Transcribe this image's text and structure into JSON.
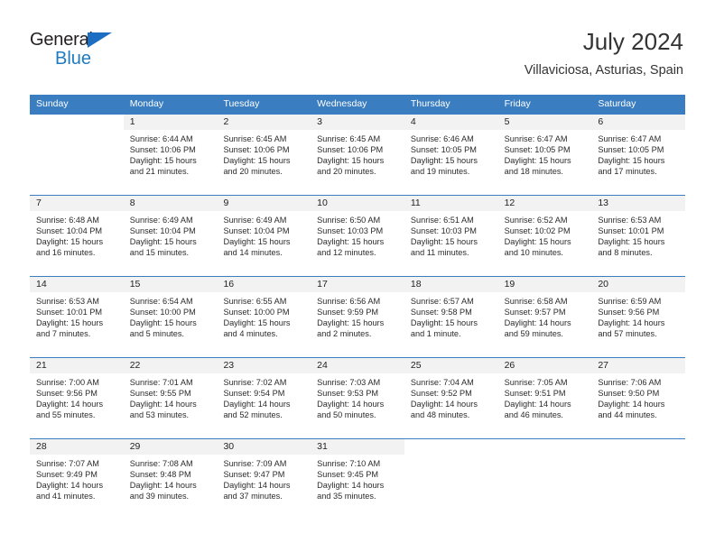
{
  "brand": {
    "name_top": "General",
    "name_bottom": "Blue",
    "logo_icon": "blue-triangle-icon",
    "color_dark": "#231f20",
    "color_blue": "#1f7bc1"
  },
  "header": {
    "title": "July 2024",
    "subtitle": "Villaviciosa, Asturias, Spain"
  },
  "theme": {
    "header_blue": "#3a7dc0",
    "daynum_gray": "#f2f2f2",
    "text_dark": "#333333"
  },
  "weekdays": [
    "Sunday",
    "Monday",
    "Tuesday",
    "Wednesday",
    "Thursday",
    "Friday",
    "Saturday"
  ],
  "weeks": [
    [
      {
        "day": "",
        "sunrise": "",
        "sunset": "",
        "daylight": "",
        "daylight2": ""
      },
      {
        "day": "1",
        "sunrise": "Sunrise: 6:44 AM",
        "sunset": "Sunset: 10:06 PM",
        "daylight": "Daylight: 15 hours",
        "daylight2": "and 21 minutes."
      },
      {
        "day": "2",
        "sunrise": "Sunrise: 6:45 AM",
        "sunset": "Sunset: 10:06 PM",
        "daylight": "Daylight: 15 hours",
        "daylight2": "and 20 minutes."
      },
      {
        "day": "3",
        "sunrise": "Sunrise: 6:45 AM",
        "sunset": "Sunset: 10:06 PM",
        "daylight": "Daylight: 15 hours",
        "daylight2": "and 20 minutes."
      },
      {
        "day": "4",
        "sunrise": "Sunrise: 6:46 AM",
        "sunset": "Sunset: 10:05 PM",
        "daylight": "Daylight: 15 hours",
        "daylight2": "and 19 minutes."
      },
      {
        "day": "5",
        "sunrise": "Sunrise: 6:47 AM",
        "sunset": "Sunset: 10:05 PM",
        "daylight": "Daylight: 15 hours",
        "daylight2": "and 18 minutes."
      },
      {
        "day": "6",
        "sunrise": "Sunrise: 6:47 AM",
        "sunset": "Sunset: 10:05 PM",
        "daylight": "Daylight: 15 hours",
        "daylight2": "and 17 minutes."
      }
    ],
    [
      {
        "day": "7",
        "sunrise": "Sunrise: 6:48 AM",
        "sunset": "Sunset: 10:04 PM",
        "daylight": "Daylight: 15 hours",
        "daylight2": "and 16 minutes."
      },
      {
        "day": "8",
        "sunrise": "Sunrise: 6:49 AM",
        "sunset": "Sunset: 10:04 PM",
        "daylight": "Daylight: 15 hours",
        "daylight2": "and 15 minutes."
      },
      {
        "day": "9",
        "sunrise": "Sunrise: 6:49 AM",
        "sunset": "Sunset: 10:04 PM",
        "daylight": "Daylight: 15 hours",
        "daylight2": "and 14 minutes."
      },
      {
        "day": "10",
        "sunrise": "Sunrise: 6:50 AM",
        "sunset": "Sunset: 10:03 PM",
        "daylight": "Daylight: 15 hours",
        "daylight2": "and 12 minutes."
      },
      {
        "day": "11",
        "sunrise": "Sunrise: 6:51 AM",
        "sunset": "Sunset: 10:03 PM",
        "daylight": "Daylight: 15 hours",
        "daylight2": "and 11 minutes."
      },
      {
        "day": "12",
        "sunrise": "Sunrise: 6:52 AM",
        "sunset": "Sunset: 10:02 PM",
        "daylight": "Daylight: 15 hours",
        "daylight2": "and 10 minutes."
      },
      {
        "day": "13",
        "sunrise": "Sunrise: 6:53 AM",
        "sunset": "Sunset: 10:01 PM",
        "daylight": "Daylight: 15 hours",
        "daylight2": "and 8 minutes."
      }
    ],
    [
      {
        "day": "14",
        "sunrise": "Sunrise: 6:53 AM",
        "sunset": "Sunset: 10:01 PM",
        "daylight": "Daylight: 15 hours",
        "daylight2": "and 7 minutes."
      },
      {
        "day": "15",
        "sunrise": "Sunrise: 6:54 AM",
        "sunset": "Sunset: 10:00 PM",
        "daylight": "Daylight: 15 hours",
        "daylight2": "and 5 minutes."
      },
      {
        "day": "16",
        "sunrise": "Sunrise: 6:55 AM",
        "sunset": "Sunset: 10:00 PM",
        "daylight": "Daylight: 15 hours",
        "daylight2": "and 4 minutes."
      },
      {
        "day": "17",
        "sunrise": "Sunrise: 6:56 AM",
        "sunset": "Sunset: 9:59 PM",
        "daylight": "Daylight: 15 hours",
        "daylight2": "and 2 minutes."
      },
      {
        "day": "18",
        "sunrise": "Sunrise: 6:57 AM",
        "sunset": "Sunset: 9:58 PM",
        "daylight": "Daylight: 15 hours",
        "daylight2": "and 1 minute."
      },
      {
        "day": "19",
        "sunrise": "Sunrise: 6:58 AM",
        "sunset": "Sunset: 9:57 PM",
        "daylight": "Daylight: 14 hours",
        "daylight2": "and 59 minutes."
      },
      {
        "day": "20",
        "sunrise": "Sunrise: 6:59 AM",
        "sunset": "Sunset: 9:56 PM",
        "daylight": "Daylight: 14 hours",
        "daylight2": "and 57 minutes."
      }
    ],
    [
      {
        "day": "21",
        "sunrise": "Sunrise: 7:00 AM",
        "sunset": "Sunset: 9:56 PM",
        "daylight": "Daylight: 14 hours",
        "daylight2": "and 55 minutes."
      },
      {
        "day": "22",
        "sunrise": "Sunrise: 7:01 AM",
        "sunset": "Sunset: 9:55 PM",
        "daylight": "Daylight: 14 hours",
        "daylight2": "and 53 minutes."
      },
      {
        "day": "23",
        "sunrise": "Sunrise: 7:02 AM",
        "sunset": "Sunset: 9:54 PM",
        "daylight": "Daylight: 14 hours",
        "daylight2": "and 52 minutes."
      },
      {
        "day": "24",
        "sunrise": "Sunrise: 7:03 AM",
        "sunset": "Sunset: 9:53 PM",
        "daylight": "Daylight: 14 hours",
        "daylight2": "and 50 minutes."
      },
      {
        "day": "25",
        "sunrise": "Sunrise: 7:04 AM",
        "sunset": "Sunset: 9:52 PM",
        "daylight": "Daylight: 14 hours",
        "daylight2": "and 48 minutes."
      },
      {
        "day": "26",
        "sunrise": "Sunrise: 7:05 AM",
        "sunset": "Sunset: 9:51 PM",
        "daylight": "Daylight: 14 hours",
        "daylight2": "and 46 minutes."
      },
      {
        "day": "27",
        "sunrise": "Sunrise: 7:06 AM",
        "sunset": "Sunset: 9:50 PM",
        "daylight": "Daylight: 14 hours",
        "daylight2": "and 44 minutes."
      }
    ],
    [
      {
        "day": "28",
        "sunrise": "Sunrise: 7:07 AM",
        "sunset": "Sunset: 9:49 PM",
        "daylight": "Daylight: 14 hours",
        "daylight2": "and 41 minutes."
      },
      {
        "day": "29",
        "sunrise": "Sunrise: 7:08 AM",
        "sunset": "Sunset: 9:48 PM",
        "daylight": "Daylight: 14 hours",
        "daylight2": "and 39 minutes."
      },
      {
        "day": "30",
        "sunrise": "Sunrise: 7:09 AM",
        "sunset": "Sunset: 9:47 PM",
        "daylight": "Daylight: 14 hours",
        "daylight2": "and 37 minutes."
      },
      {
        "day": "31",
        "sunrise": "Sunrise: 7:10 AM",
        "sunset": "Sunset: 9:45 PM",
        "daylight": "Daylight: 14 hours",
        "daylight2": "and 35 minutes."
      },
      {
        "day": "",
        "sunrise": "",
        "sunset": "",
        "daylight": "",
        "daylight2": ""
      },
      {
        "day": "",
        "sunrise": "",
        "sunset": "",
        "daylight": "",
        "daylight2": ""
      },
      {
        "day": "",
        "sunrise": "",
        "sunset": "",
        "daylight": "",
        "daylight2": ""
      }
    ]
  ]
}
